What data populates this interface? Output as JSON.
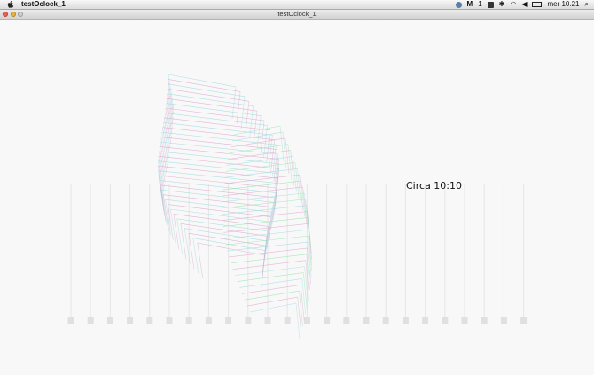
{
  "menubar": {
    "app_name": "testOclock_1",
    "status_text": "1",
    "clock": "mer 10.21"
  },
  "window": {
    "title": "testOclock_1"
  },
  "canvas": {
    "caption": "Circa 10:10",
    "columns": 24,
    "colors": {
      "background": "#f8f8f8",
      "column_line": "#e6e6e6",
      "column_foot": "#e0e0e0",
      "wire_pink": "#d9a6cc",
      "wire_cyan": "#9fd8e0",
      "wire_green": "#8fe3a8"
    }
  }
}
